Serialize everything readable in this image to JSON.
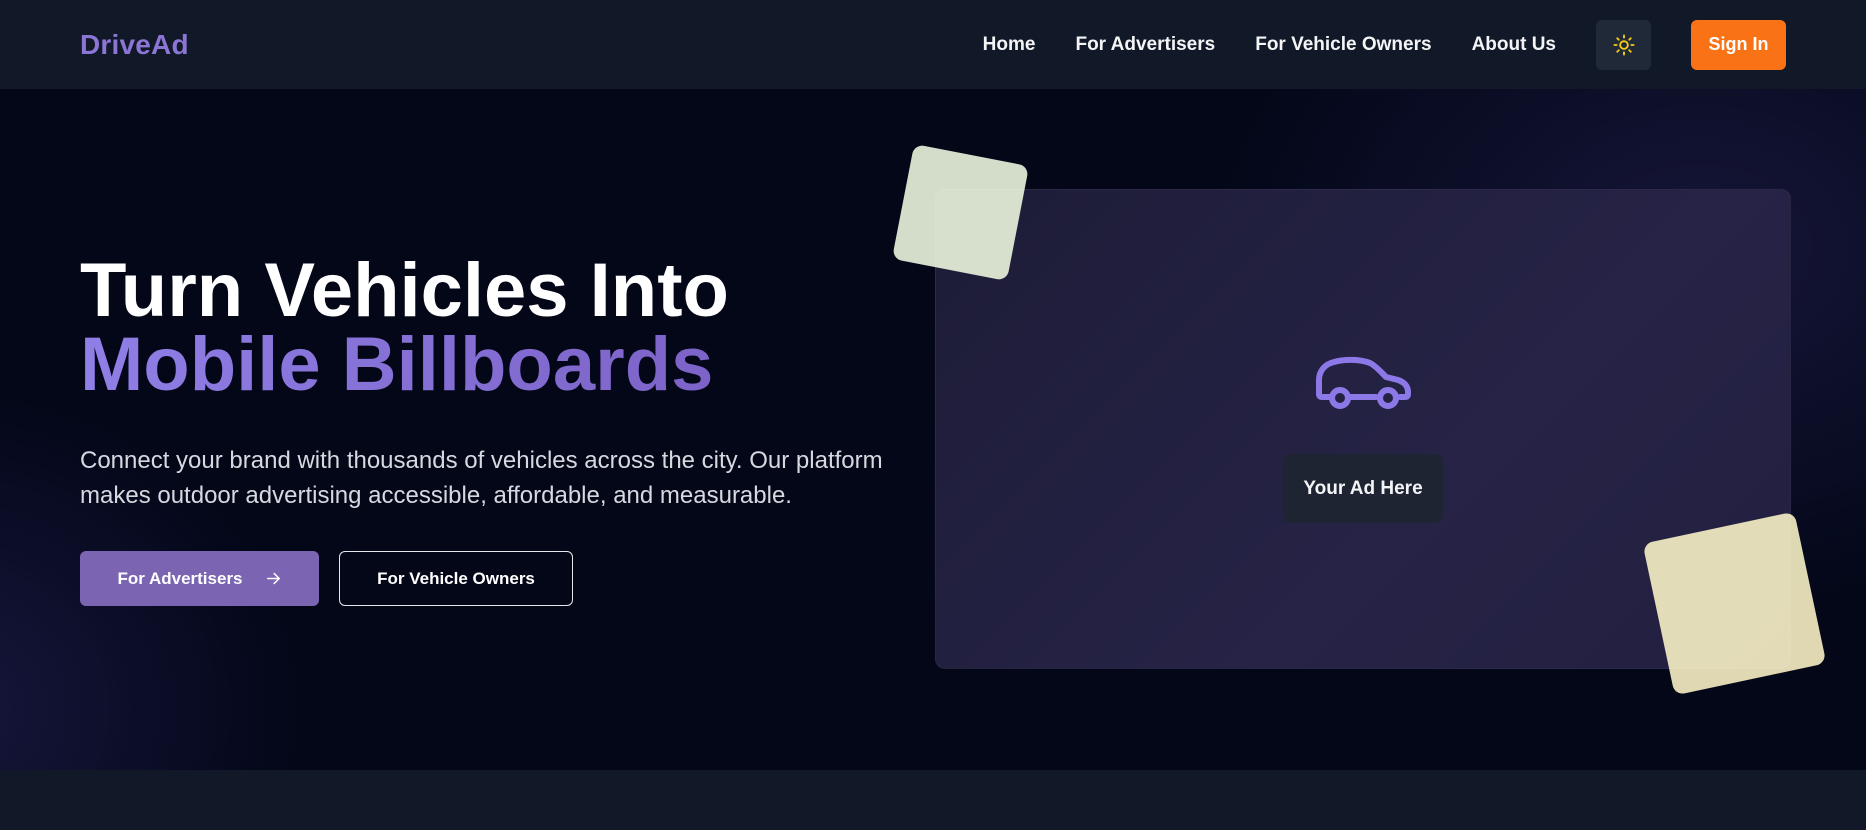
{
  "nav": {
    "brand": "DriveAd",
    "links": [
      "Home",
      "For Advertisers",
      "For Vehicle Owners",
      "About Us"
    ],
    "theme_icon": "sun-icon",
    "signin_label": "Sign In"
  },
  "hero": {
    "headline_line1": "Turn Vehicles Into",
    "headline_line2": "Mobile Billboards",
    "subtitle": "Connect your brand with thousands of vehicles across the city. Our platform makes outdoor advertising accessible, affordable, and measurable.",
    "primary_cta": "For Advertisers",
    "primary_cta_icon": "arrow-right-icon",
    "secondary_cta": "For Vehicle Owners",
    "ad_preview_label": "Your Ad Here",
    "ad_preview_icon": "car-icon"
  },
  "colors": {
    "brand": "#8b76d6",
    "accent_orange": "#f97316",
    "primary_button": "#7b64b2",
    "hero_background": "#030718",
    "nav_background": "#111827",
    "sun_icon": "#facc15"
  }
}
